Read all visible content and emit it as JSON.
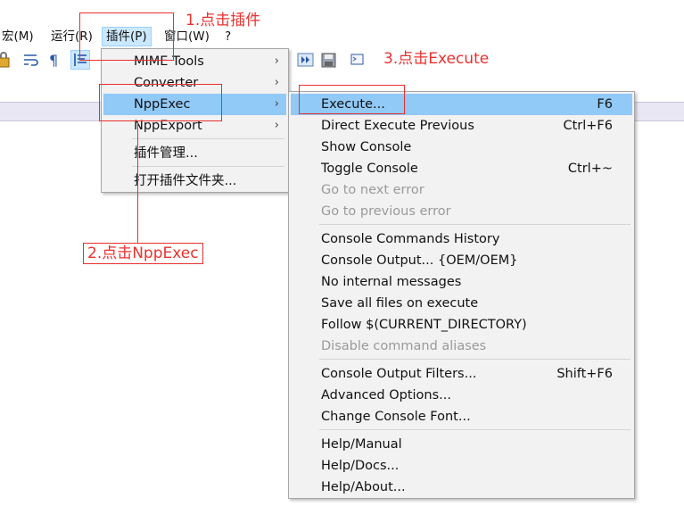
{
  "menubar": {
    "items": [
      "宏(M)",
      "运行(R)",
      "插件(P)",
      "窗口(W)",
      "?"
    ]
  },
  "plugins_menu": {
    "items": [
      "MIME Tools",
      "Converter",
      "NppExec",
      "NppExport",
      "插件管理...",
      "打开插件文件夹..."
    ]
  },
  "nppexec_menu": {
    "execute": {
      "label": "Execute...",
      "key": "F6"
    },
    "direct_execute_previous": {
      "label": "Direct Execute Previous",
      "key": "Ctrl+F6"
    },
    "show_console": {
      "label": "Show Console"
    },
    "toggle_console": {
      "label": "Toggle Console",
      "key": "Ctrl+~"
    },
    "go_next_error": {
      "label": "Go to next error"
    },
    "go_prev_error": {
      "label": "Go to previous error"
    },
    "console_commands_history": {
      "label": "Console Commands History"
    },
    "console_output": {
      "label": "Console Output... {OEM/OEM}"
    },
    "no_internal_messages": {
      "label": "No internal messages"
    },
    "save_all_files": {
      "label": "Save all files on execute"
    },
    "follow_current_directory": {
      "label": "Follow $(CURRENT_DIRECTORY)"
    },
    "disable_command_aliases": {
      "label": "Disable command aliases"
    },
    "console_output_filters": {
      "label": "Console Output Filters...",
      "key": "Shift+F6"
    },
    "advanced_options": {
      "label": "Advanced Options..."
    },
    "change_console_font": {
      "label": "Change Console Font..."
    },
    "help_manual": {
      "label": "Help/Manual"
    },
    "help_docs": {
      "label": "Help/Docs..."
    },
    "help_about": {
      "label": "Help/About..."
    }
  },
  "annotations": {
    "step1": "1.点击插件",
    "step2": "2.点击NppExec",
    "step3": "3.点击Execute"
  },
  "colors": {
    "annotation": "#e8312e",
    "highlight": "#91c9f7",
    "menu_bg": "#f2f2f2"
  }
}
